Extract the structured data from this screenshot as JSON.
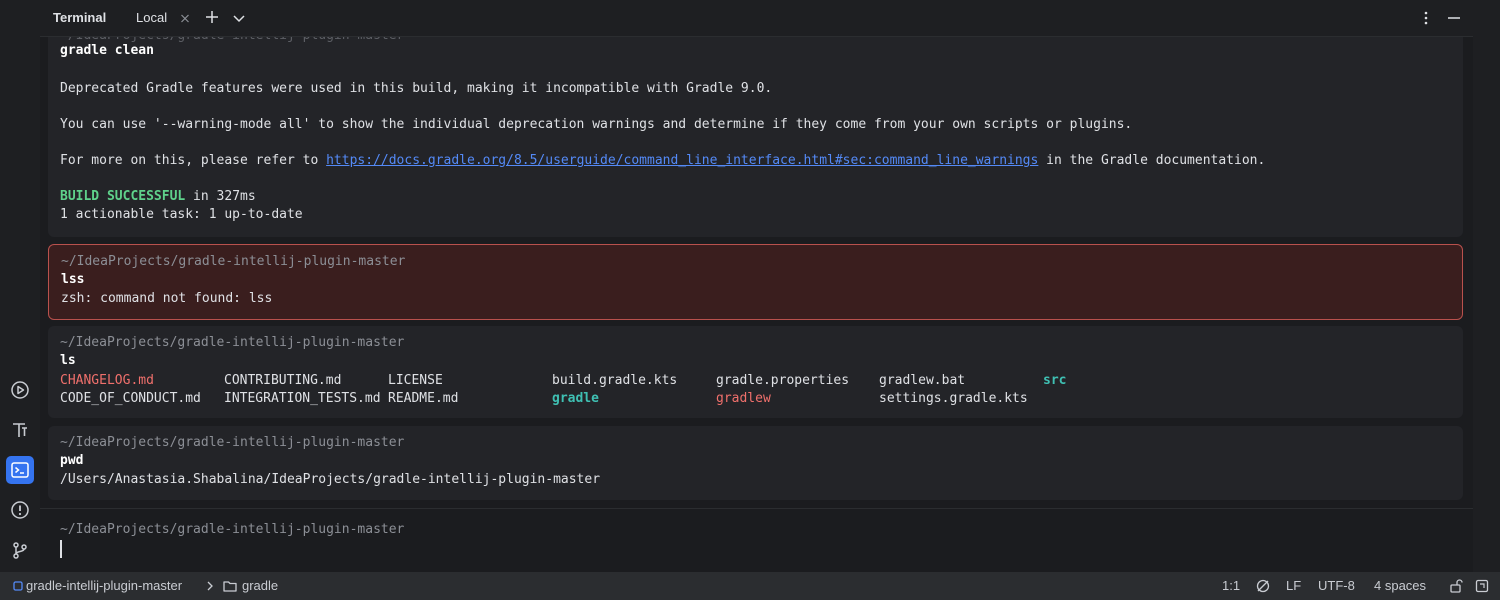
{
  "tabbar": {
    "title": "Terminal",
    "tab_label": "Local"
  },
  "blocks": {
    "gradle_clean": {
      "path_partial": "~/IdeaProjects/gradle-intellij-plugin-master",
      "command": "gradle clean",
      "line1": "Deprecated Gradle features were used in this build, making it incompatible with Gradle 9.0.",
      "line2": "You can use '--warning-mode all' to show the individual deprecation warnings and determine if they come from your own scripts or plugins.",
      "line3_prefix": "For more on this, please refer to ",
      "line3_link": "https://docs.gradle.org/8.5/userguide/command_line_interface.html#sec:command_line_warnings",
      "line3_suffix": " in the Gradle documentation.",
      "build_status": "BUILD SUCCESSFUL",
      "build_time": " in 327ms",
      "task_summary": "1 actionable task: 1 up-to-date"
    },
    "lss": {
      "path": "~/IdeaProjects/gradle-intellij-plugin-master",
      "command": "lss",
      "output": "zsh: command not found: lss"
    },
    "ls": {
      "path": "~/IdeaProjects/gradle-intellij-plugin-master",
      "command": "ls",
      "row1": [
        "CHANGELOG.md",
        "CONTRIBUTING.md",
        "LICENSE",
        "build.gradle.kts",
        "gradle.properties",
        "gradlew.bat",
        "src"
      ],
      "row2": [
        "CODE_OF_CONDUCT.md",
        "INTEGRATION_TESTS.md",
        "README.md",
        "gradle",
        "gradlew",
        "settings.gradle.kts"
      ]
    },
    "pwd": {
      "path": "~/IdeaProjects/gradle-intellij-plugin-master",
      "command": "pwd",
      "output": "/Users/Anastasia.Shabalina/IdeaProjects/gradle-intellij-plugin-master"
    }
  },
  "prompt": {
    "path": "~/IdeaProjects/gradle-intellij-plugin-master",
    "input_value": ""
  },
  "statusbar": {
    "project": "gradle-intellij-plugin-master",
    "folder": "gradle",
    "position": "1:1",
    "line_ending": "LF",
    "encoding": "UTF-8",
    "indent": "4 spaces"
  },
  "colors": {
    "accent": "#3574f0",
    "success": "#5fd28b",
    "error_border": "#b9514d",
    "link": "#548af7"
  },
  "icons": {
    "strip": [
      "run-icon",
      "text-icon",
      "terminal-icon",
      "problems-icon",
      "git-icon"
    ]
  }
}
